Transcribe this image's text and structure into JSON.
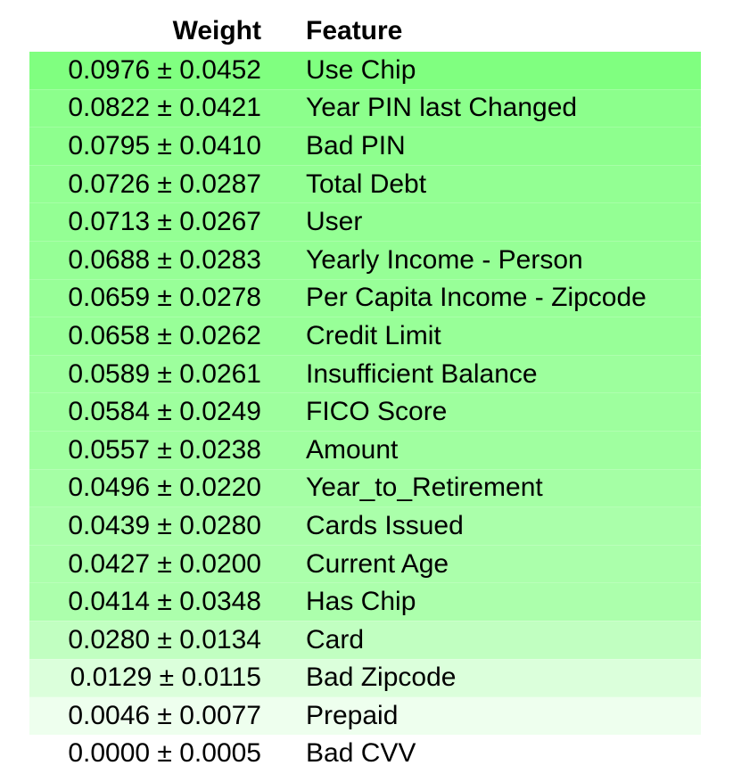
{
  "table": {
    "headers": {
      "weight": "Weight",
      "feature": "Feature"
    },
    "rows": [
      {
        "weight": "0.0976 ± 0.0452",
        "feature": "Use Chip",
        "bg": "#80ff80",
        "intensity": 1.0
      },
      {
        "weight": "0.0822 ± 0.0421",
        "feature": "Year PIN last Changed",
        "bg": "#8cff8c",
        "intensity": 0.84
      },
      {
        "weight": "0.0795 ± 0.0410",
        "feature": "Bad PIN",
        "bg": "#8eff8e",
        "intensity": 0.81
      },
      {
        "weight": "0.0726 ± 0.0287",
        "feature": "Total Debt",
        "bg": "#93ff93",
        "intensity": 0.74
      },
      {
        "weight": "0.0713 ± 0.0267",
        "feature": "User",
        "bg": "#94ff94",
        "intensity": 0.73
      },
      {
        "weight": "0.0688 ± 0.0283",
        "feature": "Yearly Income - Person",
        "bg": "#96ff96",
        "intensity": 0.7
      },
      {
        "weight": "0.0659 ± 0.0278",
        "feature": "Per Capita Income - Zipcode",
        "bg": "#98ff98",
        "intensity": 0.68
      },
      {
        "weight": "0.0658 ± 0.0262",
        "feature": "Credit Limit",
        "bg": "#98ff98",
        "intensity": 0.67
      },
      {
        "weight": "0.0589 ± 0.0261",
        "feature": "Insufficient Balance",
        "bg": "#9dff9d",
        "intensity": 0.6
      },
      {
        "weight": "0.0584 ± 0.0249",
        "feature": "FICO Score",
        "bg": "#9eff9e",
        "intensity": 0.6
      },
      {
        "weight": "0.0557 ± 0.0238",
        "feature": "Amount",
        "bg": "#a0ffa0",
        "intensity": 0.57
      },
      {
        "weight": "0.0496 ± 0.0220",
        "feature": "Year_to_Retirement",
        "bg": "#a5ffa5",
        "intensity": 0.51
      },
      {
        "weight": "0.0439 ± 0.0280",
        "feature": "Cards Issued",
        "bg": "#aaffaa",
        "intensity": 0.45
      },
      {
        "weight": "0.0427 ± 0.0200",
        "feature": "Current Age",
        "bg": "#abffab",
        "intensity": 0.44
      },
      {
        "weight": "0.0414 ± 0.0348",
        "feature": "Has Chip",
        "bg": "#acffac",
        "intensity": 0.42
      },
      {
        "weight": "0.0280 ± 0.0134",
        "feature": "Card",
        "bg": "#c1ffc1",
        "intensity": 0.29
      },
      {
        "weight": "0.0129 ± 0.0115",
        "feature": "Bad Zipcode",
        "bg": "#dbffdb",
        "intensity": 0.13
      },
      {
        "weight": "0.0046 ± 0.0077",
        "feature": "Prepaid",
        "bg": "#eeffee",
        "intensity": 0.05
      },
      {
        "weight": "0.0000 ± 0.0005",
        "feature": "Bad CVV",
        "bg": "#ffffff",
        "intensity": 0.0
      }
    ]
  }
}
